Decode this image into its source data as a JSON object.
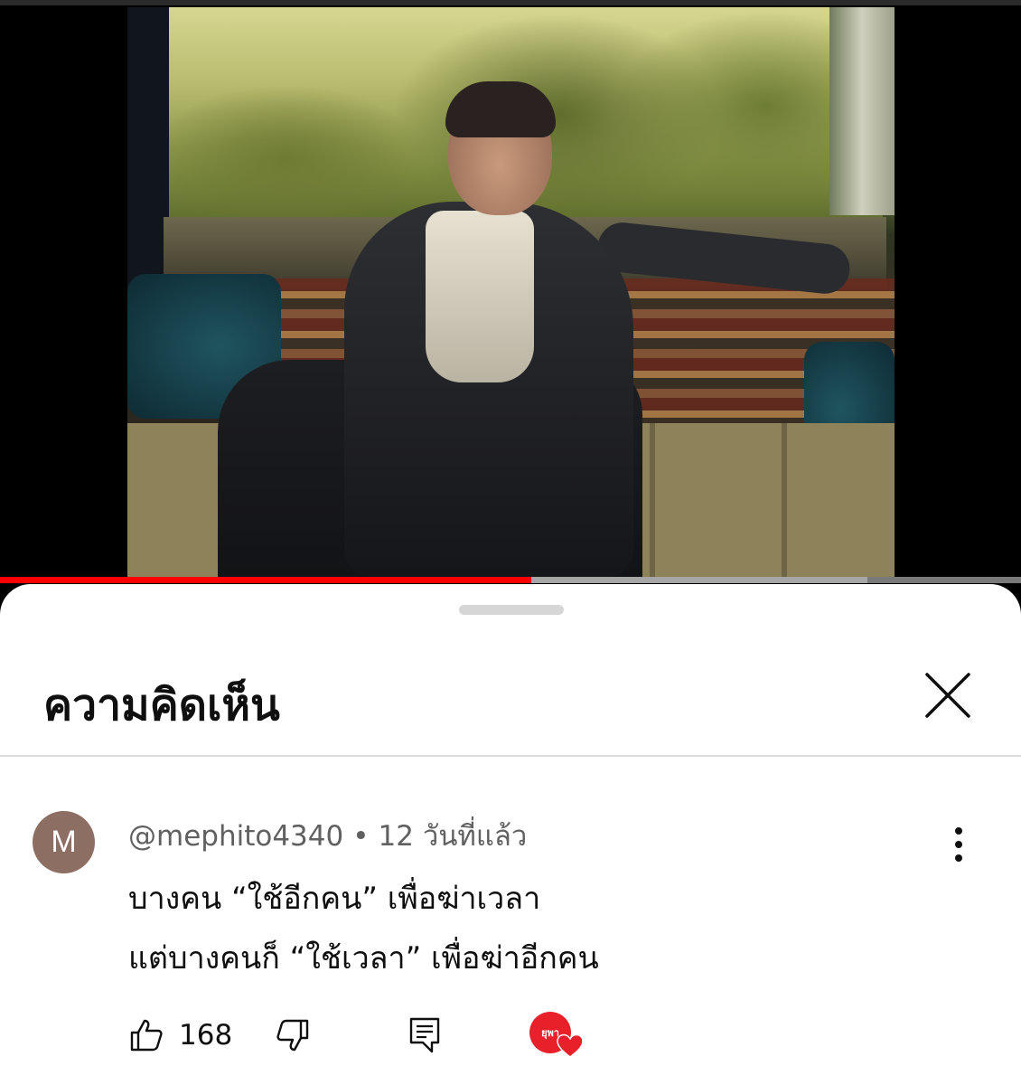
{
  "video": {
    "progress_percent": 52,
    "buffered_percent": 85
  },
  "comments_panel": {
    "title": "ความคิดเห็น",
    "comment": {
      "avatar_letter": "M",
      "avatar_color": "#8d6e63",
      "author": "@mephito4340",
      "separator": "•",
      "time": "12 วันที่แล้ว",
      "lines": [
        "บางคน “ใช้อีกคน” เพื่อฆ่าเวลา",
        "แต่บางคนก็ “ใช้เวลา” เพื่อฆ่าอีกคน"
      ],
      "like_count": "168",
      "creator_heart": {
        "label": "ยุพา",
        "color": "#e8202a"
      }
    }
  },
  "icons": {
    "close": "close-icon",
    "more": "more-vertical-icon",
    "like": "thumb-up-icon",
    "dislike": "thumb-down-icon",
    "reply": "reply-comment-icon",
    "heart": "heart-icon"
  },
  "colors": {
    "accent": "#ff0000",
    "text_primary": "#0f0f0f",
    "text_secondary": "#606060"
  }
}
